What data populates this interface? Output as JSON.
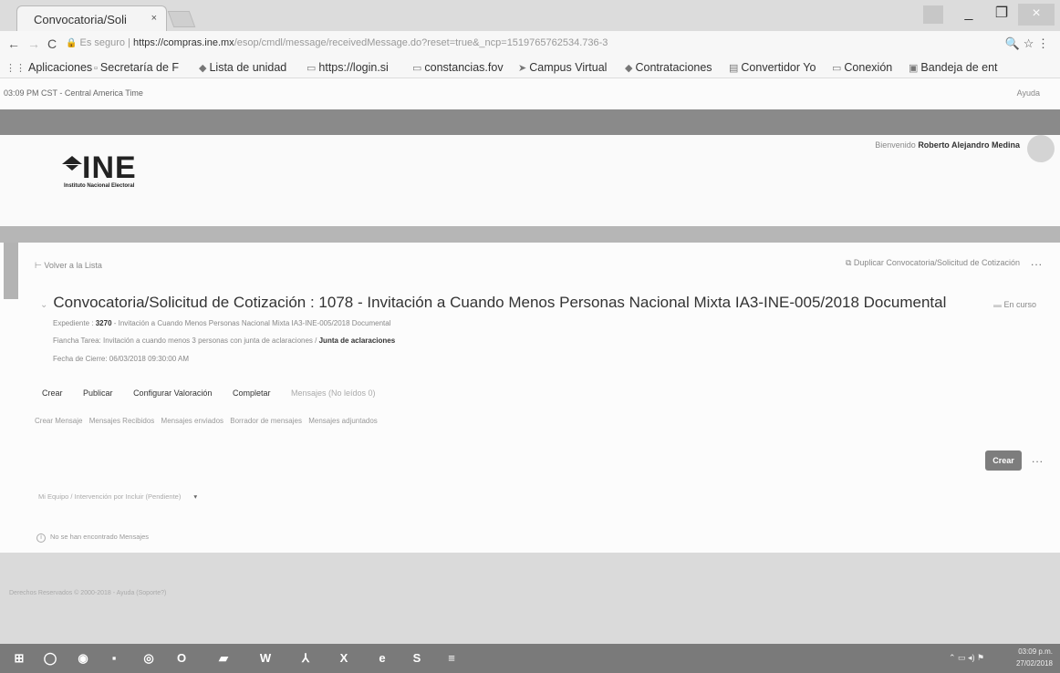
{
  "browser": {
    "tab_title": "Convocatoria/Soli",
    "tab_close": "×",
    "url_security": "Es seguro",
    "url_scheme_host": "https://compras.ine.mx",
    "url_path": "/esop/cmdl/message/receivedMessage.do?reset=true&_ncp=1519765762534.736-3",
    "bookmarks": [
      "Aplicaciones",
      "Secretaría de F",
      "Lista de unidad",
      "https://login.si",
      "constancias.fov",
      "Campus Virtual",
      "Contrataciones",
      "Convertidor Yo",
      "Conexión",
      "Bandeja de ent"
    ]
  },
  "app": {
    "timezone": "03:09 PM CST - Central America Time",
    "help": "Ayuda",
    "welcome_prefix": "Bienvenido",
    "user_name": "Roberto Alejandro Medina",
    "logo_text": "INE",
    "logo_subtitle": "Instituto Nacional Electoral",
    "back_link": "Volver a la Lista",
    "duplicate_link": "Duplicar Convocatoria/Solicitud de Cotización",
    "more": "...",
    "title": "Convocatoria/Solicitud de Cotización : 1078 - Invitación a Cuando Menos Personas Nacional Mixta IA3-INE-005/2018 Documental",
    "status": "En curso",
    "meta": {
      "expediente_label": "Expediente :",
      "expediente_num": "3270",
      "expediente_desc": "- Invitación a Cuando Menos Personas Nacional Mixta IA3-INE-005/2018 Documental",
      "tarea_label": "Fiancha Tarea: Invitación a cuando menos 3 personas con junta de aclaraciones /",
      "tarea_bold": "Junta de aclaraciones",
      "cierre": "Fecha de Cierre: 06/03/2018 09:30:00 AM"
    },
    "actions": [
      "Crear",
      "Publicar",
      "Configurar Valoración",
      "Completar"
    ],
    "messages_tab": "Mensajes (No leídos 0)",
    "sublinks": [
      "Crear Mensaje",
      "Mensajes Recibidos",
      "Mensajes enviados",
      "Borrador de mensajes",
      "Mensajes adjuntados"
    ],
    "create_button": "Crear",
    "filter_text": "Mi Equipo / Intervención por Incluir (Pendiente)",
    "notice": "No se han encontrado Mensajes",
    "footer_text": "Derechos Reservados © 2000-2018 - Ayuda (Soporte?)"
  },
  "taskbar": {
    "time": "03:09 p.m.",
    "date": "27/02/2018"
  }
}
